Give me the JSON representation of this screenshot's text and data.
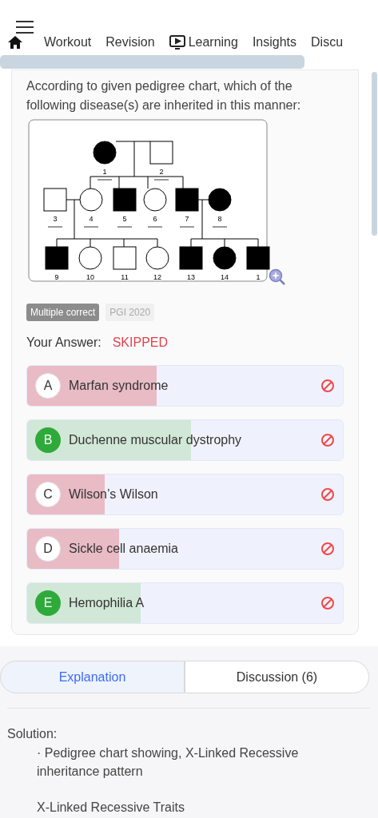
{
  "nav": {
    "tabs": [
      {
        "label": "Workout",
        "selected": false,
        "kind": "text"
      },
      {
        "label": "Revision",
        "selected": false,
        "kind": "text"
      },
      {
        "label": "Learning",
        "selected": false,
        "kind": "video"
      },
      {
        "label": "Insights",
        "selected": false,
        "kind": "text"
      },
      {
        "label": "Discu",
        "selected": false,
        "kind": "text"
      }
    ]
  },
  "question": {
    "text": "According to given pedigree chart, which of the following disease(s) are inherited in this manner:",
    "pedigree": [
      {
        "label": "1",
        "kind": "female",
        "affected": true
      },
      {
        "label": "2",
        "kind": "male",
        "affected": false
      },
      {
        "label": "3",
        "kind": "male",
        "affected": false
      },
      {
        "label": "4",
        "kind": "female",
        "affected": false
      },
      {
        "label": "5",
        "kind": "male",
        "affected": true
      },
      {
        "label": "6",
        "kind": "female",
        "affected": false
      },
      {
        "label": "7",
        "kind": "male",
        "affected": true
      },
      {
        "label": "8",
        "kind": "female",
        "affected": true
      },
      {
        "label": "9",
        "kind": "male",
        "affected": true
      },
      {
        "label": "10",
        "kind": "female",
        "affected": false
      },
      {
        "label": "11",
        "kind": "male",
        "affected": false
      },
      {
        "label": "12",
        "kind": "female",
        "affected": false
      },
      {
        "label": "13",
        "kind": "male",
        "affected": true
      },
      {
        "label": "14",
        "kind": "female",
        "affected": true
      },
      {
        "label": "1",
        "kind": "male",
        "affected": true
      }
    ],
    "tags": [
      {
        "label": "Multiple correct",
        "kind": "type"
      },
      {
        "label": "PGI 2020",
        "kind": "source"
      }
    ],
    "answer_label": "Your Answer:",
    "answer_value": "SKIPPED",
    "options": [
      {
        "letter": "A",
        "text": "Marfan syndrome",
        "correct": false,
        "level": 0.41
      },
      {
        "letter": "B",
        "text": "Duchenne muscular dystrophy",
        "correct": true,
        "level": 0.52
      },
      {
        "letter": "C",
        "text": "Wilson’s Wilson",
        "correct": false,
        "level": 0.245
      },
      {
        "letter": "D",
        "text": "Sickle cell anaemia",
        "correct": false,
        "level": 0.29
      },
      {
        "letter": "E",
        "text": "Hemophilia A",
        "correct": true,
        "level": 0.36
      }
    ]
  },
  "bottom_tabs": [
    {
      "label": "Explanation",
      "selected": true
    },
    {
      "label": "Discussion (6)",
      "selected": false
    }
  ],
  "solution": {
    "heading": "Solution:",
    "bullet": "· Pedigree chart showing, X-Linked Recessive inheritance pattern",
    "subheading": "X-Linked Recessive Traits"
  }
}
